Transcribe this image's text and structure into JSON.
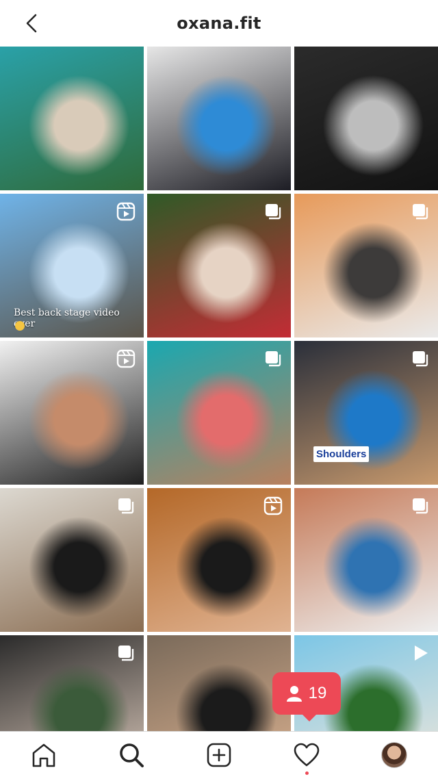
{
  "header": {
    "title": "oxana.fit",
    "back_icon": "chevron-left-icon"
  },
  "grid": {
    "tiles": [
      {
        "badge": "none",
        "colors": [
          "#2aa1a8",
          "#d9cbb9",
          "#2f6a3a"
        ]
      },
      {
        "badge": "none",
        "colors": [
          "#e6e6e6",
          "#2e8bd6",
          "#1d1d24"
        ]
      },
      {
        "badge": "none",
        "colors": [
          "#2b2b2b",
          "#bdbdbd",
          "#121212"
        ]
      },
      {
        "badge": "reel",
        "colors": [
          "#6fb3e8",
          "#c7dff3",
          "#5b5449"
        ],
        "caption": "Best back stage video ever"
      },
      {
        "badge": "carousel",
        "colors": [
          "#2f5a27",
          "#e6d3c4",
          "#c32c35"
        ]
      },
      {
        "badge": "carousel",
        "colors": [
          "#e79a5a",
          "#3d3b3a",
          "#eaeaea"
        ]
      },
      {
        "badge": "reel",
        "colors": [
          "#f1f1f1",
          "#c58b6a",
          "#202020"
        ]
      },
      {
        "badge": "carousel",
        "colors": [
          "#1aa8b0",
          "#e36c6c",
          "#b9805e"
        ]
      },
      {
        "badge": "carousel",
        "colors": [
          "#2a2f3a",
          "#1e79c8",
          "#c7996d"
        ],
        "label": "Shoulders"
      },
      {
        "badge": "carousel",
        "colors": [
          "#dcd8d0",
          "#1a1a1a",
          "#8a6d52"
        ]
      },
      {
        "badge": "reel",
        "colors": [
          "#b46828",
          "#1a1a1a",
          "#e0b392"
        ]
      },
      {
        "badge": "carousel",
        "colors": [
          "#c57a58",
          "#2f73b2",
          "#eeeeee"
        ]
      },
      {
        "badge": "carousel",
        "colors": [
          "#2b2b2b",
          "#3b5b3a",
          "#d8c6b8"
        ]
      },
      {
        "badge": "none",
        "colors": [
          "#7a6a5a",
          "#1b1b1b",
          "#d9b08f"
        ]
      },
      {
        "badge": "video",
        "colors": [
          "#7cc6e6",
          "#2c6e2c",
          "#f0e7da"
        ]
      }
    ]
  },
  "notification": {
    "count": "19",
    "icon": "person-icon"
  },
  "tabbar": {
    "items": [
      {
        "name": "home",
        "icon": "home-icon"
      },
      {
        "name": "search",
        "icon": "search-icon"
      },
      {
        "name": "new-post",
        "icon": "plus-square-icon"
      },
      {
        "name": "activity",
        "icon": "heart-icon"
      },
      {
        "name": "profile",
        "icon": "avatar"
      }
    ]
  },
  "colors": {
    "accent_red": "#ed4956",
    "text": "#262626",
    "divider": "#dbdbdb"
  }
}
